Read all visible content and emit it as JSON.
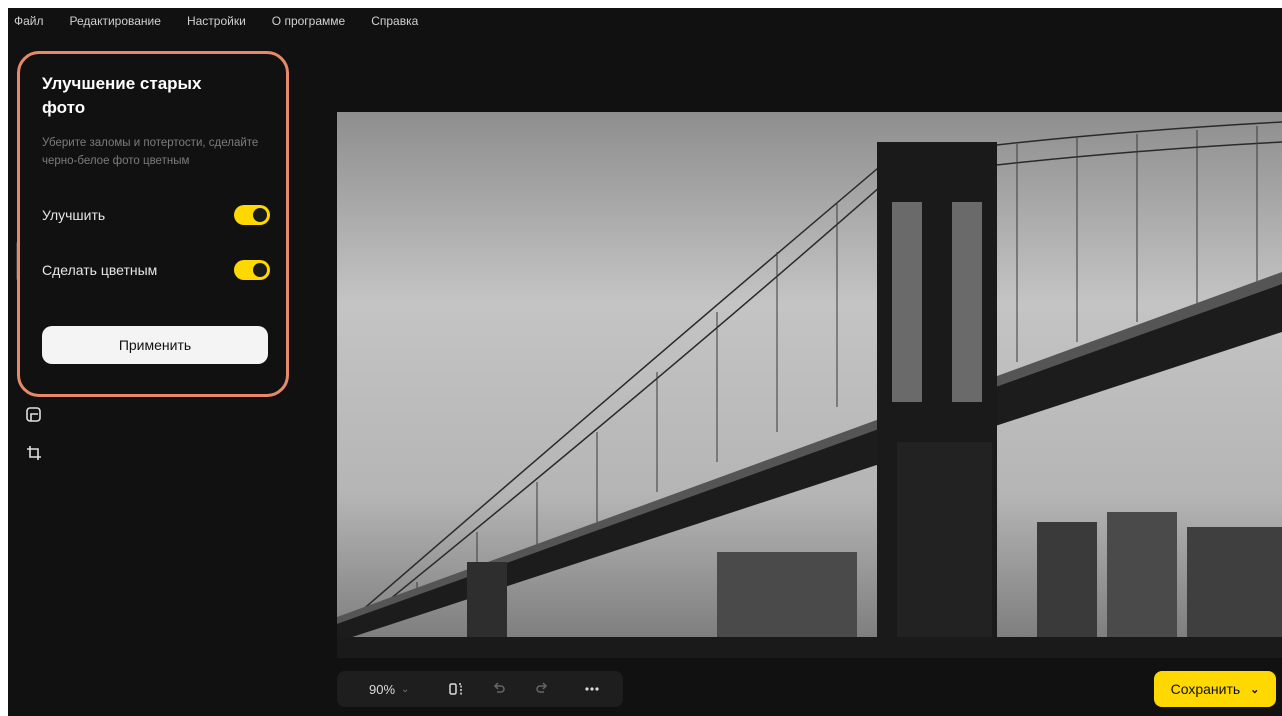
{
  "menu": [
    "Файл",
    "Редактирование",
    "Настройки",
    "О программе",
    "Справка"
  ],
  "panel": {
    "title": "Улучшение старых фото",
    "subtitle": "Уберите заломы и потертости, сделайте черно-белое фото цветным",
    "toggles": [
      {
        "label": "Улучшить",
        "on": true
      },
      {
        "label": "Сделать цветным",
        "on": true
      }
    ],
    "apply_label": "Применить"
  },
  "sidebar_icons": [
    "restore-icon",
    "crop-icon"
  ],
  "toolbar": {
    "zoom": "90%",
    "icons": [
      "compare-icon",
      "undo-icon",
      "redo-icon",
      "more-icon"
    ]
  },
  "save_label": "Сохранить",
  "colors": {
    "accent": "#ffd800",
    "highlight": "#e8896a",
    "background": "#111111"
  }
}
